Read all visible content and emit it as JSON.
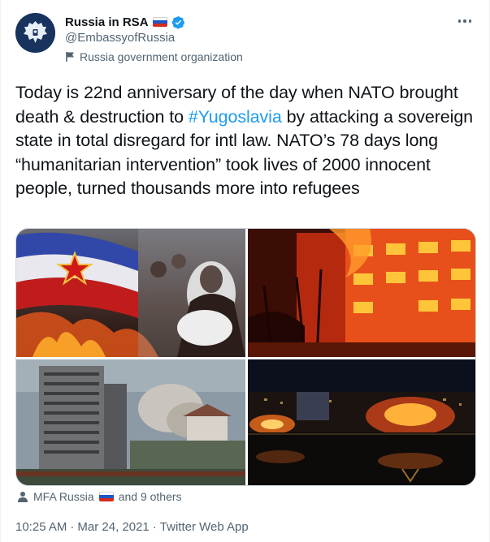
{
  "author": {
    "display_name": "Russia in RSA",
    "handle": "@EmbassyofRussia",
    "label": "Russia government organization"
  },
  "tweet": {
    "text_before": "Today is 22nd anniversary of the day when NATO brought death & destruction to ",
    "hashtag": "#Yugoslavia",
    "text_after": " by attacking a sovereign state in total disregard for intl law. NATO’s 78 days long “humanitarian intervention” took lives of 2000 innocent people, turned thousands more into refugees"
  },
  "tagged": {
    "first": "MFA Russia",
    "rest": "and 9 others"
  },
  "meta": {
    "time": "10:25 AM",
    "sep1": "·",
    "date": "Mar 24, 2021",
    "sep2": "·",
    "source": "Twitter Web App"
  },
  "colors": {
    "link": "#1d9bf0",
    "muted": "#536471",
    "text": "#0f1419"
  },
  "icons": {
    "verified": "verified-badge-icon",
    "flag": "russia-flag-icon",
    "org": "flag-outline-icon",
    "more": "more-dots-icon",
    "tag": "person-icon"
  }
}
